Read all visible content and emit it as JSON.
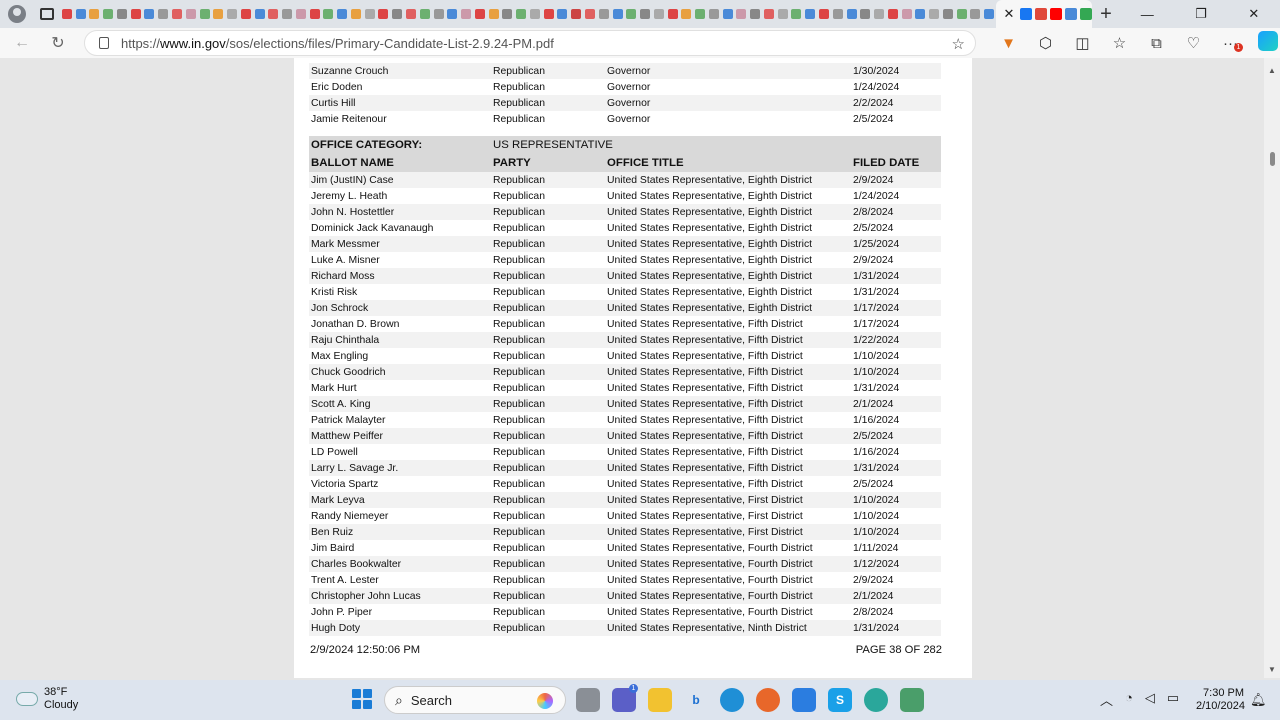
{
  "browser": {
    "url_prefix": "https://",
    "url_host": "www.in.gov",
    "url_path": "/sos/elections/files/Primary-Candidate-List-2.9.24-PM.pdf",
    "tab_colors": [
      "#d44",
      "#4a8ad8",
      "#e8a040",
      "#6cb070",
      "#888",
      "#d44",
      "#4a8ad8",
      "#999",
      "#e06060",
      "#c9a",
      "#6cb070",
      "#e8a040",
      "#aaa",
      "#d44",
      "#4a8ad8",
      "#e06060",
      "#999",
      "#c9a",
      "#d44",
      "#6cb070",
      "#4a8ad8",
      "#e8a040",
      "#aaa",
      "#d44",
      "#888",
      "#e06060",
      "#6cb070",
      "#999",
      "#4a8ad8",
      "#c9a",
      "#d44",
      "#e8a040",
      "#888",
      "#6cb070",
      "#aaa",
      "#d44",
      "#4a8ad8",
      "#c44",
      "#e06060",
      "#999",
      "#4a8ad8",
      "#6cb070",
      "#888",
      "#aaa",
      "#d44",
      "#e8a040",
      "#6cb070",
      "#999",
      "#4a8ad8",
      "#c9a",
      "#888",
      "#e06060",
      "#aaa",
      "#6cb070",
      "#4a8ad8",
      "#d44",
      "#999",
      "#4a8ad8",
      "#888",
      "#aaa",
      "#d44",
      "#c9a",
      "#4a8ad8",
      "#aaa",
      "#888",
      "#6cb070",
      "#999",
      "#4a8ad8"
    ],
    "after_tab_colors": [
      "#1877f2",
      "#e0483a",
      "#ff0000",
      "#4a8ad8",
      "#34a853"
    ]
  },
  "top_rows": [
    {
      "name": "Suzanne Crouch",
      "party": "Republican",
      "office": "Governor",
      "filed": "1/30/2024"
    },
    {
      "name": "Eric Doden",
      "party": "Republican",
      "office": "Governor",
      "filed": "1/24/2024"
    },
    {
      "name": "Curtis Hill",
      "party": "Republican",
      "office": "Governor",
      "filed": "2/2/2024"
    },
    {
      "name": "Jamie Reitenour",
      "party": "Republican",
      "office": "Governor",
      "filed": "2/5/2024"
    }
  ],
  "category": {
    "label": "OFFICE CATEGORY:",
    "value": "US REPRESENTATIVE",
    "headers": [
      "BALLOT NAME",
      "PARTY",
      "OFFICE TITLE",
      "FILED DATE"
    ]
  },
  "rows": [
    {
      "name": "Jim (JustIN) Case",
      "party": "Republican",
      "office": "United States Representative, Eighth District",
      "filed": "2/9/2024"
    },
    {
      "name": "Jeremy L. Heath",
      "party": "Republican",
      "office": "United States Representative, Eighth District",
      "filed": "1/24/2024"
    },
    {
      "name": "John N. Hostettler",
      "party": "Republican",
      "office": "United States Representative, Eighth District",
      "filed": "2/8/2024"
    },
    {
      "name": "Dominick Jack Kavanaugh",
      "party": "Republican",
      "office": "United States Representative, Eighth District",
      "filed": "2/5/2024"
    },
    {
      "name": "Mark Messmer",
      "party": "Republican",
      "office": "United States Representative, Eighth District",
      "filed": "1/25/2024"
    },
    {
      "name": "Luke A. Misner",
      "party": "Republican",
      "office": "United States Representative, Eighth District",
      "filed": "2/9/2024"
    },
    {
      "name": "Richard Moss",
      "party": "Republican",
      "office": "United States Representative, Eighth District",
      "filed": "1/31/2024"
    },
    {
      "name": "Kristi Risk",
      "party": "Republican",
      "office": "United States Representative, Eighth District",
      "filed": "1/31/2024"
    },
    {
      "name": "Jon Schrock",
      "party": "Republican",
      "office": "United States Representative, Eighth District",
      "filed": "1/17/2024"
    },
    {
      "name": "Jonathan D. Brown",
      "party": "Republican",
      "office": "United States Representative, Fifth District",
      "filed": "1/17/2024"
    },
    {
      "name": "Raju Chinthala",
      "party": "Republican",
      "office": "United States Representative, Fifth District",
      "filed": "1/22/2024"
    },
    {
      "name": "Max Engling",
      "party": "Republican",
      "office": "United States Representative, Fifth District",
      "filed": "1/10/2024"
    },
    {
      "name": "Chuck Goodrich",
      "party": "Republican",
      "office": "United States Representative, Fifth District",
      "filed": "1/10/2024"
    },
    {
      "name": "Mark Hurt",
      "party": "Republican",
      "office": "United States Representative, Fifth District",
      "filed": "1/31/2024"
    },
    {
      "name": "Scott A. King",
      "party": "Republican",
      "office": "United States Representative, Fifth District",
      "filed": "2/1/2024"
    },
    {
      "name": "Patrick Malayter",
      "party": "Republican",
      "office": "United States Representative, Fifth District",
      "filed": "1/16/2024"
    },
    {
      "name": "Matthew Peiffer",
      "party": "Republican",
      "office": "United States Representative, Fifth District",
      "filed": "2/5/2024"
    },
    {
      "name": "LD Powell",
      "party": "Republican",
      "office": "United States Representative, Fifth District",
      "filed": "1/16/2024"
    },
    {
      "name": "Larry L. Savage Jr.",
      "party": "Republican",
      "office": "United States Representative, Fifth District",
      "filed": "1/31/2024"
    },
    {
      "name": "Victoria Spartz",
      "party": "Republican",
      "office": "United States Representative, Fifth District",
      "filed": "2/5/2024"
    },
    {
      "name": "Mark Leyva",
      "party": "Republican",
      "office": "United States Representative, First District",
      "filed": "1/10/2024"
    },
    {
      "name": "Randy Niemeyer",
      "party": "Republican",
      "office": "United States Representative, First District",
      "filed": "1/10/2024"
    },
    {
      "name": "Ben Ruiz",
      "party": "Republican",
      "office": "United States Representative, First District",
      "filed": "1/10/2024"
    },
    {
      "name": "Jim Baird",
      "party": "Republican",
      "office": "United States Representative, Fourth District",
      "filed": "1/11/2024"
    },
    {
      "name": "Charles Bookwalter",
      "party": "Republican",
      "office": "United States Representative, Fourth District",
      "filed": "1/12/2024"
    },
    {
      "name": "Trent A. Lester",
      "party": "Republican",
      "office": "United States Representative, Fourth District",
      "filed": "2/9/2024"
    },
    {
      "name": "Christopher John Lucas",
      "party": "Republican",
      "office": "United States Representative, Fourth District",
      "filed": "2/1/2024"
    },
    {
      "name": "John P. Piper",
      "party": "Republican",
      "office": "United States Representative, Fourth District",
      "filed": "2/8/2024"
    },
    {
      "name": "Hugh Doty",
      "party": "Republican",
      "office": "United States Representative, Ninth District",
      "filed": "1/31/2024"
    }
  ],
  "footer": {
    "timestamp": "2/9/2024 12:50:06 PM",
    "page": "PAGE 38 OF 282"
  },
  "taskbar": {
    "temperature": "38°F",
    "condition": "Cloudy",
    "search_label": "Search",
    "chat_badge": "1",
    "time": "7:30 PM",
    "date": "2/10/2024"
  }
}
